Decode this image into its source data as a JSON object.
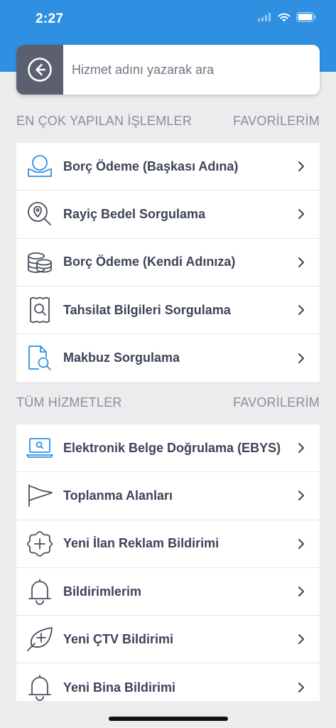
{
  "status": {
    "time": "2:27"
  },
  "search": {
    "placeholder": "Hizmet adını yazarak ara"
  },
  "popular": {
    "title": "EN ÇOK YAPILAN İŞLEMLER",
    "favorites_label": "FAVORİLERİM",
    "items": [
      {
        "label": "Borç Ödeme (Başkası Adına)",
        "icon": "payment-hand-icon"
      },
      {
        "label": "Rayiç Bedel Sorgulama",
        "icon": "location-search-icon"
      },
      {
        "label": "Borç Ödeme (Kendi Adınıza)",
        "icon": "coins-icon"
      },
      {
        "label": "Tahsilat Bilgileri Sorgulama",
        "icon": "receipt-search-icon"
      },
      {
        "label": "Makbuz Sorgulama",
        "icon": "document-search-icon"
      }
    ]
  },
  "all": {
    "title": "TÜM HİZMETLER",
    "favorites_label": "FAVORİLERİM",
    "items": [
      {
        "label": "Elektronik Belge Doğrulama (EBYS)",
        "icon": "laptop-search-icon"
      },
      {
        "label": "Toplanma Alanları",
        "icon": "flag-icon"
      },
      {
        "label": "Yeni İlan Reklam Bildirimi",
        "icon": "badge-plus-icon"
      },
      {
        "label": "Bildirimlerim",
        "icon": "bell-icon"
      },
      {
        "label": "Yeni ÇTV Bildirimi",
        "icon": "leaf-plus-icon"
      },
      {
        "label": "Yeni Bina Bildirimi",
        "icon": "bell-icon"
      }
    ]
  },
  "colors": {
    "brand": "#2f90e2",
    "back_button": "#5b6070",
    "icon_blue": "#2f90e2",
    "icon_gray": "#4a4f5e"
  }
}
